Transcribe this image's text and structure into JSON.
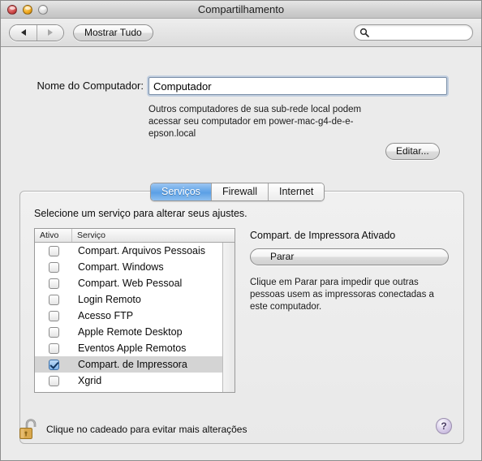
{
  "window": {
    "title": "Compartilhamento",
    "controls": {
      "close": "close-button",
      "minimize": "minimize-button",
      "zoom": "zoom-button"
    }
  },
  "toolbar": {
    "back_label": "back-arrow",
    "forward_label": "forward-arrow",
    "show_all_label": "Mostrar Tudo",
    "search_placeholder": "",
    "search_value": ""
  },
  "computer_name": {
    "label": "Nome do Computador:",
    "value": "Computador",
    "description": "Outros computadores de sua sub-rede local podem acessar seu computador em power-mac-g4-de-e-epson.local",
    "edit_label": "Editar..."
  },
  "tabs": [
    {
      "label": "Serviços",
      "active": true
    },
    {
      "label": "Firewall",
      "active": false
    },
    {
      "label": "Internet",
      "active": false
    }
  ],
  "panel": {
    "instruction": "Selecione um serviço para alterar seus ajustes.",
    "columns": {
      "active": "Ativo",
      "service": "Serviço"
    },
    "services": [
      {
        "name": "Compart. Arquivos Pessoais",
        "checked": false,
        "selected": false
      },
      {
        "name": "Compart. Windows",
        "checked": false,
        "selected": false
      },
      {
        "name": "Compart. Web Pessoal",
        "checked": false,
        "selected": false
      },
      {
        "name": "Login Remoto",
        "checked": false,
        "selected": false
      },
      {
        "name": "Acesso FTP",
        "checked": false,
        "selected": false
      },
      {
        "name": "Apple Remote Desktop",
        "checked": false,
        "selected": false
      },
      {
        "name": "Eventos Apple Remotos",
        "checked": false,
        "selected": false
      },
      {
        "name": "Compart. de Impressora",
        "checked": true,
        "selected": true
      },
      {
        "name": "Xgrid",
        "checked": false,
        "selected": false
      }
    ],
    "detail": {
      "title": "Compart. de Impressora Ativado",
      "action_label": "Parar",
      "description": "Clique em Parar para impedir que outras pessoas usem as impressoras conectadas a este computador."
    },
    "help_label": "?"
  },
  "footer": {
    "lock_text": "Clique no cadeado para evitar mais alterações",
    "lock_state": "unlocked"
  },
  "colors": {
    "accent_tab": "#65a6e8",
    "checkbox_checked": "#7fb2e8",
    "help_button": "#b9a8d4",
    "lock_body": "#d9a84e"
  }
}
